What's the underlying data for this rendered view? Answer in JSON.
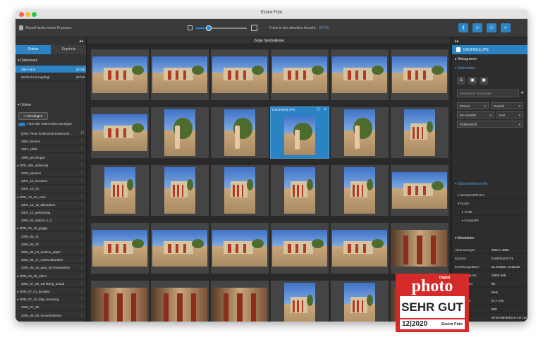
{
  "window": {
    "title": "Excire Foto"
  },
  "toolbar": {
    "status": "Aktuell laufen keine Prozesse",
    "count_label": "Fotos in der aktuellen Ansicht:",
    "count_value": "32748",
    "zoom_value": 0.25
  },
  "left": {
    "tab_folders": "Ordner",
    "tab_results": "Ergebnis",
    "db_header": "Datenbank",
    "db_rows": [
      {
        "label": "Alle Fotos",
        "count": "32748"
      },
      {
        "label": "Kürzlich hinzugefügt",
        "count": "32748"
      }
    ],
    "folders_header": "Ordner",
    "add_button": "+ Hinzufügen",
    "toggle_label": "Fotos der Unterordner anzeigen",
    "folders": [
      "(DN1 Photo RAW 2020-Dokument…",
      "1994_blumen",
      "1997_1998",
      "1999_plochingen",
      "2002_alte_wohnung",
      "2002_spanien",
      "2004_10_01canon",
      "2004_10_24",
      "2004_10_24_casa",
      "2004_12_12_akkordeon",
      "2004_12_geburtstag",
      "2005_03_elopice n_d",
      "2005_05_15_goggo",
      "2005_05_21",
      "2005_05_22",
      "2005_06_04_markus_apple",
      "2005_06_17_schimuskweiten",
      "2005_06_24_auto_schmuckwelten",
      "2005_06_26_eltern",
      "2005_07_06_wernberg_urlaub",
      "2005_07_01_kroatien",
      "2005_07_22_löge_leonberg",
      "2005_07_28",
      "2005_08_08_sonnenblumen"
    ]
  },
  "center": {
    "symbol_bar": "Zeige Symbolleiste",
    "selected_caption": "DSCF5016.JPG"
  },
  "right": {
    "file_name": "DSCF5016.JPG",
    "histogram": "Histogramm",
    "keywords": "Stichwörter",
    "keyword_input_placeholder": "Stichwörter hinzufügen",
    "tags": [
      [
        "Person",
        "Gesicht"
      ],
      [
        "Ein Gesicht",
        "Hell"
      ],
      [
        "Profilansicht"
      ]
    ],
    "hierarchy_header": "Stichworthierarchie",
    "hierarchy": [
      "benutzerdefiniert",
      "Excire",
      "Inhalt",
      "Fotografie"
    ],
    "metadata_header": "Metadaten",
    "metadata": [
      {
        "k": "Abmessungen",
        "v": "3264 x 4896"
      },
      {
        "k": "Kamera",
        "v": "FUJIFILM X-T1"
      },
      {
        "k": "Erstellungsdatum",
        "v": "31.8.2020, 13:35:22"
      },
      {
        "k": "Belichtungszeit",
        "v": "1/500 Sek."
      },
      {
        "k": "Blendenzahl",
        "v": "f/8"
      },
      {
        "k": "Blitz",
        "v": "Nein"
      },
      {
        "k": "Brennweite",
        "v": "27.7 mm"
      },
      {
        "k": "ISO",
        "v": "800"
      },
      {
        "k": "Objektiv",
        "v": "XF18-55mmF2.8-4 R LM OIS"
      }
    ]
  },
  "badge": {
    "brand_small": "Digital",
    "brand": "photo",
    "verdict": "SEHR GUT",
    "issue": "12|2020",
    "product": "Excire Foto"
  },
  "colors": {
    "accent": "#2b83c4",
    "badge_red": "#d52a2a",
    "check": "#4caf50"
  }
}
